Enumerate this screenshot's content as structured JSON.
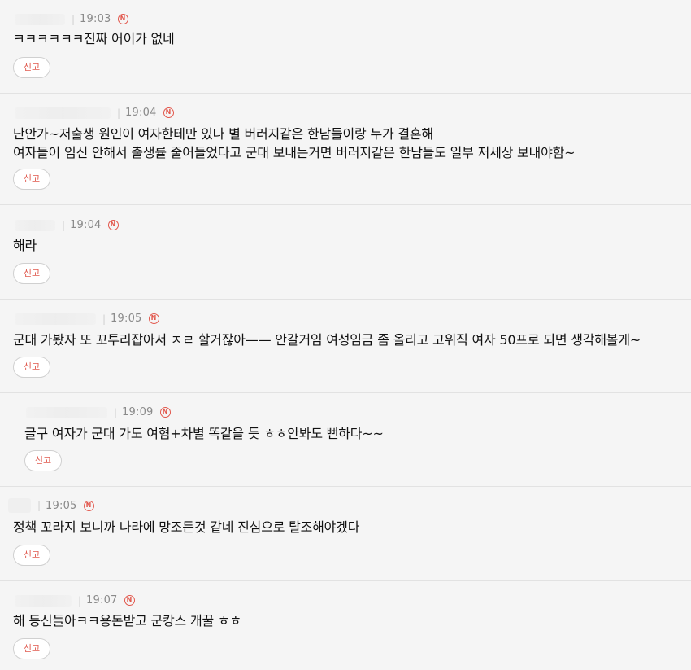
{
  "badge_label": "N",
  "divider_char": "|",
  "accent_color": "#e2574c",
  "comments": [
    {
      "time": "19:03",
      "lines": [
        "ㅋㅋㅋㅋㅋㅋ진짜 어이가 없네"
      ],
      "report_label": "신고"
    },
    {
      "time": "19:04",
      "lines": [
        "난안가~저출생 원인이 여자한테만 있나 별 버러지같은 한남들이랑 누가 결혼해",
        "여자들이 임신 안해서 출생률 줄어들었다고 군대 보내는거면 버러지같은 한남들도 일부 저세상 보내야함~"
      ],
      "report_label": "신고"
    },
    {
      "time": "19:04",
      "lines": [
        "해라"
      ],
      "report_label": "신고"
    },
    {
      "time": "19:05",
      "lines": [
        "군대 가봤자 또 꼬투리잡아서 ㅈㄹ 할거잖아—— 안갈거임 여성임금 좀 올리고 고위직 여자 50프로 되면 생각해볼게~"
      ],
      "report_label": "신고"
    },
    {
      "time": "19:09",
      "lines": [
        "글구 여자가 군대 가도 여혐+차별 똑같을 듯 ㅎㅎ안봐도 뻔하다~~"
      ],
      "report_label": "신고"
    },
    {
      "time": "19:05",
      "lines": [
        "정책 꼬라지 보니까 나라에 망조든것 같네 진심으로 탈조해야겠다"
      ],
      "report_label": "신고"
    },
    {
      "time": "19:07",
      "lines": [
        "해 등신들아ㅋㅋ용돈받고 군캉스 개꿀 ㅎㅎ"
      ],
      "report_label": "신고"
    }
  ]
}
